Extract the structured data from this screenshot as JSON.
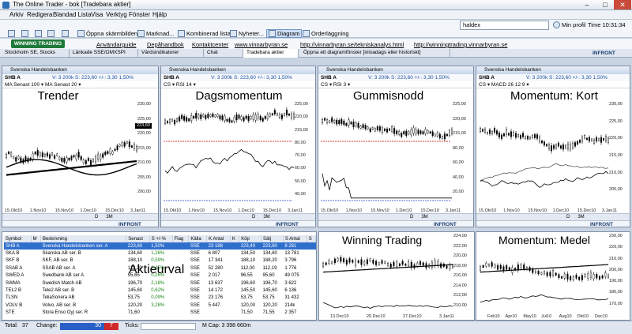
{
  "window": {
    "title": "The Online Trader - bok [Tradebara aktier]"
  },
  "menu": [
    "Arkiv",
    "Redigera",
    "Blandad Lista",
    "Visa",
    "Verktyg",
    "Fönster",
    "Hjälp"
  ],
  "toolbar": {
    "buttons": [
      "Öppna skärmbilden",
      "Marknad...",
      "Kombinerad lista",
      "Nyheter...",
      "Diagram",
      "Orderläggning"
    ],
    "search_value": "haldex",
    "profile": "Min profil",
    "time": "Time 10:31:34"
  },
  "linkbar": {
    "logo": "WINNING TRADING",
    "links": [
      "Användarguide",
      "Depåhandbok",
      "Kontaktcenter",
      "www.vinnarbyran.se",
      "http://vinnarbyran.se/tekniskanalys.html",
      "http://winningtrading.vinnarbyran.se"
    ]
  },
  "tabs": [
    "Stockholm SE, Stocks",
    "Länkade SSE/OMXSPI",
    "Värdsindikatorer",
    "Chat",
    "Tradebara aktier",
    "Öppna ett diagramfönster [inloadags eller historiskt]"
  ],
  "brand": "INFRONT",
  "panels": [
    {
      "head": "Svenska Handelsbanken",
      "symbol": "SHB A",
      "info": "V: 3 200k  S: 223,60 +/-: 3,30  1,50%",
      "sub": "MA Senast 100 ▾  MA Senast 20 ▾",
      "title": "Trender",
      "xlabels": [
        "15.Okt10",
        "1.Nov10",
        "15.Nov10",
        "1.Dec10",
        "15.Dec10",
        "3.Jan11"
      ],
      "ylabels": [
        "230,00",
        "225,00",
        "220,00",
        "215,00",
        "210,00",
        "205,00",
        "200,00"
      ]
    },
    {
      "head": "Svenska Handelsbanken",
      "symbol": "SHB A",
      "info": "V: 3 200k  S: 223,60 +/-: 3,30  1,50%",
      "sub": "CS ▾  RSI 14 ▾",
      "title": "Dagsmomentum",
      "xlabels": [
        "15.Okt10",
        "1.Nov10",
        "15.Nov10",
        "1.Dec10",
        "15.Dec10",
        "3.Jan11"
      ],
      "ylabels": [
        "225,00",
        "220,00",
        "215,00",
        "80,00",
        "70,00",
        "60,00",
        "50,00",
        "40,00"
      ]
    },
    {
      "head": "Svenska Handelsbanken",
      "symbol": "SHB A",
      "info": "V: 3 200k  S: 223,60 +/-: 3,30  1,50%",
      "sub": "CS ▾  RSI 3 ▾",
      "title": "Gummisnodd",
      "xlabels": [
        "15.Okt10",
        "1.Nov10",
        "15.Nov10",
        "1.Dec10",
        "15.Dec10",
        "3.Jan11"
      ],
      "ylabels": [
        "225,00",
        "220,00",
        "215,00",
        "80,00",
        "60,00",
        "40,00",
        "20,00"
      ]
    },
    {
      "head": "Svenska Handelsbanken",
      "symbol": "SHB A",
      "info": "V: 3 200k  S: 223,60 +/-: 3,30  1,50%",
      "sub": "CS ▾  MACD 26 12 9 ▾",
      "title": "Momentum: Kort",
      "xlabels": [
        "15.Okt10",
        "1.Nov10",
        "15.Nov10",
        "1.Dec10",
        "15.Dec10",
        "3.Jan11"
      ],
      "ylabels": [
        "230,00",
        "225,00",
        "220,00",
        "215,00",
        "210,00",
        "205,00"
      ]
    }
  ],
  "lower_panels": [
    {
      "title": "Winning Trading",
      "xlabels": [
        "13.Dec10",
        "20.Dec10",
        "27.Dec10",
        "3.Jan11"
      ],
      "ylabels": [
        "224,00",
        "222,00",
        "220,00",
        "218,00",
        "216,00",
        "214,00",
        "212,00",
        "210,00"
      ]
    },
    {
      "title": "Momentum: Medel",
      "xlabels": [
        "Feb10",
        "Apr10",
        "May10",
        "Jul10",
        "Aug10",
        "Okt10",
        "Dec10"
      ],
      "ylabels": [
        "230,00",
        "220,00",
        "210,00",
        "200,00",
        "190,00",
        "180,00",
        "170,00"
      ]
    }
  ],
  "panel_footer": {
    "zoom": "3M",
    "interval": "D"
  },
  "table": {
    "label": "Aktieurval",
    "columns": [
      "Symbol",
      "M",
      "Beskrivning",
      "Senast",
      "S +/-%",
      "Flag",
      "Källa",
      "K Antal",
      "K",
      "Köp",
      "Sälj",
      "S Antal",
      "S"
    ],
    "rows": [
      [
        "SHB A",
        "",
        "Svenska Handelsbanken ser. A",
        "223,60",
        "1,50%",
        "",
        "SSE",
        "23 188",
        "",
        "223,40",
        "223,60",
        "8 281",
        ""
      ],
      [
        "SKA B",
        "",
        "Skanska AB ser. B",
        "134,60",
        "1,26%",
        "",
        "SSE",
        "6 807",
        "",
        "134,50",
        "134,60",
        "13 781",
        ""
      ],
      [
        "SKF B",
        "",
        "SKF, AB ser. B",
        "188,10",
        "0,59%",
        "",
        "SSE",
        "17 341",
        "",
        "188,10",
        "188,20",
        "3 796",
        ""
      ],
      [
        "SSAB A",
        "",
        "SSAB AB ser. A",
        "112,20",
        "0,45%",
        "",
        "SSE",
        "52 280",
        "",
        "112,00",
        "112,19",
        "1 776",
        ""
      ],
      [
        "SWED A",
        "",
        "Swedbank AB ser A",
        "95,65",
        "0,26%",
        "",
        "SSE",
        "2 017",
        "",
        "96,55",
        "95,60",
        "49 075",
        ""
      ],
      [
        "SWMA",
        "",
        "Swedish Match AB",
        "196,70",
        "2,18%",
        "",
        "SSE",
        "13 637",
        "",
        "196,60",
        "196,70",
        "3 622",
        ""
      ],
      [
        "TEL2 B",
        "",
        "Tele2 AB ser. B",
        "145,60",
        "0,62%",
        "",
        "SSE",
        "14 172",
        "",
        "145,50",
        "145,60",
        "6 136",
        ""
      ],
      [
        "TLSN",
        "",
        "TeliaSonera AB",
        "53,75",
        "0,09%",
        "",
        "SSE",
        "23 176",
        "",
        "53,75",
        "53,75",
        "31 432",
        ""
      ],
      [
        "VOLV B",
        "",
        "Volvo, AB ser. B",
        "120,20",
        "3,28%",
        "",
        "SSE",
        "5 447",
        "",
        "120,00",
        "120,20",
        "214k",
        ""
      ],
      [
        "STE",
        "",
        "Stora Enso Oyj ser. R",
        "71,60",
        "",
        "",
        "SSE",
        "",
        "",
        "71,50",
        "71,55",
        "2 357",
        ""
      ]
    ]
  },
  "status": {
    "total_label": "Total:",
    "total": "37",
    "change_label": "Change:",
    "change_down": "30",
    "change_up": "7",
    "ticks_label": "Ticks:",
    "mcap": "M Cap: 3 398 660m"
  }
}
